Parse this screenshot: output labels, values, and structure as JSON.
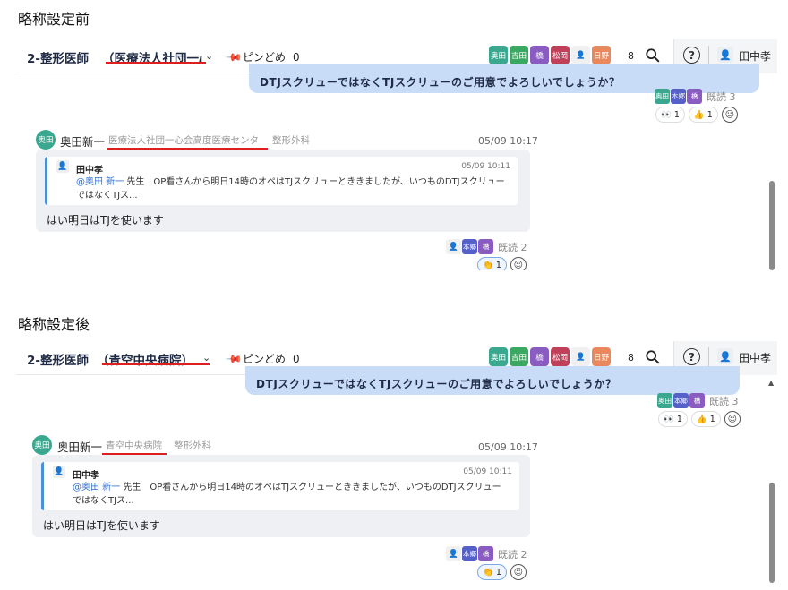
{
  "colors": {
    "accent_underline": "#dd1f1f",
    "bubble_mine": "#c9dcf7",
    "bubble_other": "#eef0f3",
    "quote_bar": "#4a90d9",
    "mention": "#2f6fd1"
  },
  "members": [
    {
      "label": "奥田",
      "color": "#3aa88f"
    },
    {
      "label": "吉田",
      "color": "#3aa860"
    },
    {
      "label": "橋",
      "color": "#8a5bc0"
    },
    {
      "label": "松岡",
      "color": "#c0405a"
    },
    {
      "label": "👤",
      "color": "#f0f0f0"
    },
    {
      "label": "日野",
      "color": "#e8885c"
    }
  ],
  "before": {
    "section_title": "略称設定前",
    "header": {
      "room_name": "2-整形医師",
      "room_org": "（医療法人社団一心",
      "pin_label": "ピンどめ",
      "pin_count": "0",
      "member_count": "8",
      "user_name": "田中孝"
    },
    "my_message": {
      "text": "DTJスクリューではなくTJスクリューのご用意でよろしいでしょうか？",
      "readers": [
        "奥田",
        "本郷",
        "橋"
      ],
      "read_label": "既読 3",
      "reactions": [
        {
          "emoji": "👀",
          "count": "1"
        },
        {
          "emoji": "👍",
          "count": "1"
        }
      ]
    },
    "message": {
      "avatar": "奥田",
      "sender": "奥田新一",
      "org": "医療法人社団一心会高度医療センタ",
      "dept": "整形外科",
      "time": "05/09 10:17",
      "quote_name": "田中孝",
      "quote_time": "05/09 10:11",
      "quote_mention": "@奥田 新一",
      "quote_body": " 先生　OP看さんから明日14時のオペはTJスクリューとききましたが、いつものDTJスクリューではなくTJス...",
      "text": "はい明日はTJを使います",
      "readers": [
        "👤",
        "本郷",
        "橋"
      ],
      "read_label": "既読 2",
      "reaction": {
        "emoji": "👏",
        "count": "1"
      }
    }
  },
  "after": {
    "section_title": "略称設定後",
    "header": {
      "room_name": "2-整形医師",
      "room_org": "（青空中央病院）",
      "pin_label": "ピンどめ",
      "pin_count": "0",
      "member_count": "8",
      "user_name": "田中孝"
    },
    "my_message": {
      "text": "DTJスクリューではなくTJスクリューのご用意でよろしいでしょうか？",
      "readers": [
        "奥田",
        "本郷",
        "橋"
      ],
      "read_label": "既読 3",
      "reactions": [
        {
          "emoji": "👀",
          "count": "1"
        },
        {
          "emoji": "👍",
          "count": "1"
        }
      ]
    },
    "message": {
      "avatar": "奥田",
      "sender": "奥田新一",
      "org": "青空中央病院",
      "dept": "整形外科",
      "time": "05/09 10:17",
      "quote_name": "田中孝",
      "quote_time": "05/09 10:11",
      "quote_mention": "@奥田 新一",
      "quote_body": " 先生　OP看さんから明日14時のオペはTJスクリューとききましたが、いつものDTJスクリューではなくTJス...",
      "text": "はい明日はTJを使います",
      "readers": [
        "👤",
        "本郷",
        "橋"
      ],
      "read_label": "既読 2",
      "reaction": {
        "emoji": "👏",
        "count": "1"
      }
    }
  }
}
